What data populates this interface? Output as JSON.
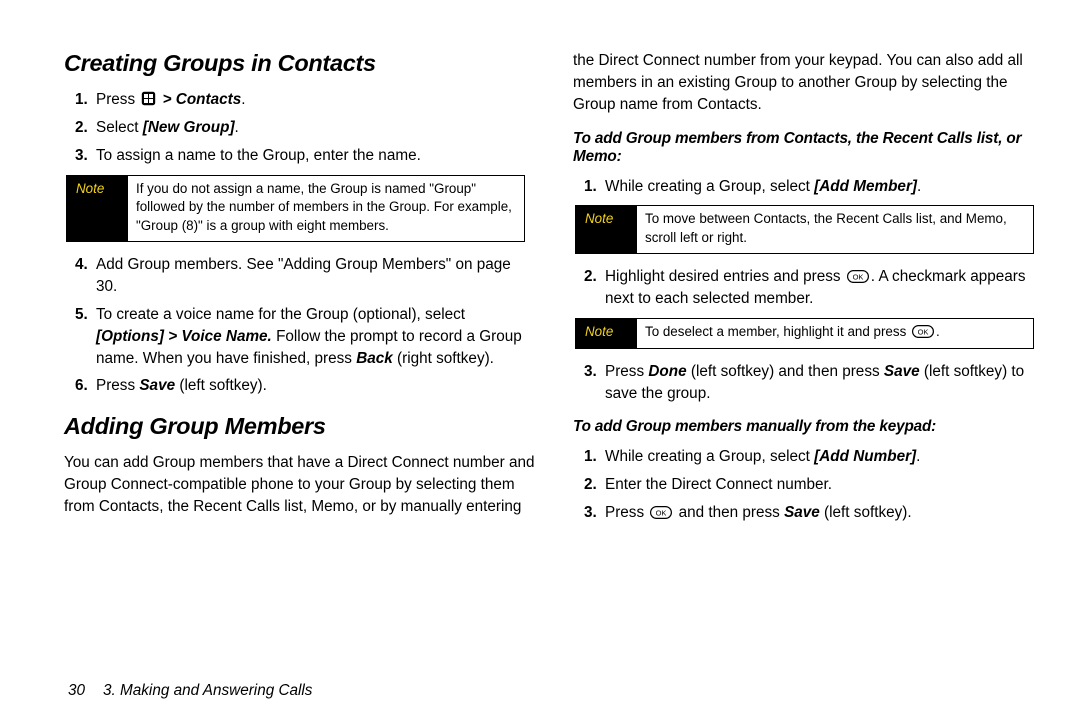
{
  "left": {
    "heading1": "Creating Groups in Contacts",
    "items1": {
      "i1a": "Press",
      "i1b": "> Contacts",
      "i1c": ".",
      "i2a": "Select",
      "i2b": "[New Group]",
      "i2c": ".",
      "i3": "To assign a name to the Group, enter the name.",
      "i4": "Add Group members. See \"Adding Group Members\" on page 30.",
      "i5a": "To create a voice name for the Group (optional), select",
      "i5b": "[Options] > Voice Name.",
      "i5c": "Follow the prompt to record a Group name. When you have finished, press",
      "i5d": "Back",
      "i5e": "(right softkey).",
      "i6a": "Press",
      "i6b": "Save",
      "i6c": "(left softkey)."
    },
    "note1": {
      "label": "Note",
      "body": "If you do not assign a name, the Group is named \"Group\" followed by the number of members in the Group. For example, \"Group (8)\" is a group with eight members."
    },
    "heading2": "Adding Group Members",
    "para2": "You can add Group members that have a Direct Connect number and Group Connect-compatible phone to your Group by selecting them from Contacts, the Recent Calls list, Memo, or by manually entering"
  },
  "right": {
    "paraTop": "the Direct Connect number from your keypad. You can also add all members in an existing Group to another Group by selecting the Group name from Contacts.",
    "sub1": "To add Group members from Contacts, the Recent Calls list, or Memo:",
    "itemsA": {
      "a1a": "While creating a Group, select",
      "a1b": "[Add Member]",
      "a1c": ".",
      "a2a": "Highlight desired entries and press",
      "a2b": ". A checkmark appears next to each selected member.",
      "a3a": "Press",
      "a3b": "Done",
      "a3c": "(left softkey) and then press",
      "a3d": "Save",
      "a3e": "(left softkey) to save the group."
    },
    "noteA": {
      "label": "Note",
      "body": "To move between Contacts, the Recent Calls list, and Memo, scroll left or right."
    },
    "noteB": {
      "label": "Note",
      "body": "To deselect a member, highlight it and press"
    },
    "sub2": "To add Group members manually from the keypad:",
    "itemsB": {
      "b1a": "While creating a Group, select",
      "b1b": "[Add Number]",
      "b1c": ".",
      "b2": "Enter the Direct Connect number.",
      "b3a": "Press",
      "b3b": "and then press",
      "b3c": "Save",
      "b3d": "(left softkey)."
    }
  },
  "footer": {
    "page": "30",
    "chapter": "3. Making and Answering Calls"
  }
}
